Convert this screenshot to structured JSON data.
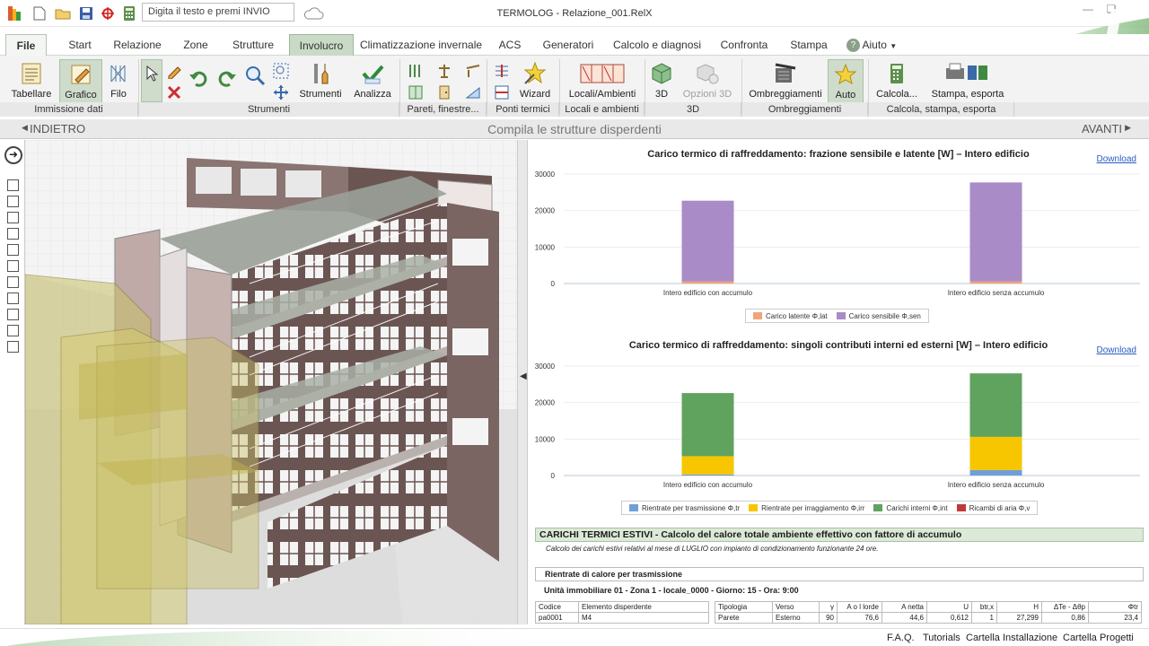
{
  "window": {
    "title": "TERMOLOG - Relazione_001.RelX",
    "search_placeholder": "Digita il testo e premi INVIO"
  },
  "tabs": [
    {
      "label": "File"
    },
    {
      "label": "Start"
    },
    {
      "label": "Relazione"
    },
    {
      "label": "Zone"
    },
    {
      "label": "Strutture"
    },
    {
      "label": "Involucro"
    },
    {
      "label": "Climatizzazione invernale"
    },
    {
      "label": "ACS"
    },
    {
      "label": "Generatori"
    },
    {
      "label": "Calcolo e diagnosi"
    },
    {
      "label": "Confronta"
    },
    {
      "label": "Stampa"
    },
    {
      "label": "Aiuto"
    }
  ],
  "active_tab": "Involucro",
  "ribbon": {
    "buttons": {
      "tabellare": "Tabellare",
      "grafico": "Grafico",
      "filo": "Filo",
      "strumenti": "Strumenti",
      "analizza": "Analizza",
      "wizard": "Wizard",
      "locali": "Locali/Ambienti",
      "btn3d": "3D",
      "opzioni3d": "Opzioni 3D",
      "ombreggiamenti": "Ombreggiamenti",
      "auto": "Auto",
      "calcola": "Calcola...",
      "stampa": "Stampa, esporta"
    },
    "groups": {
      "immissione": "Immissione dati",
      "strumenti": "Strumenti",
      "pareti": "Pareti, finestre...",
      "ponti": "Ponti termici",
      "locali": "Locali e ambienti",
      "g3d": "3D",
      "ombreggiamenti": "Ombreggiamenti",
      "calcola": "Calcola, stampa, esporta"
    }
  },
  "nav": {
    "back": "INDIETRO",
    "center": "Compila le strutture disperdenti",
    "forward": "AVANTI"
  },
  "charts": {
    "download_label": "Download",
    "chart1_title": "Carico termico di raffreddamento: frazione sensibile e latente [W] – Intero edificio",
    "chart2_title": "Carico termico di raffreddamento: singoli contributi interni ed esterni [W] – Intero edificio"
  },
  "chart_data": [
    {
      "type": "bar",
      "stacked": true,
      "title": "Carico termico di raffreddamento: frazione sensibile e latente [W] – Intero edificio",
      "categories": [
        "Intero edificio con accumulo",
        "Intero edificio senza accumulo"
      ],
      "ylim": [
        0,
        30000
      ],
      "yticks": [
        0,
        10000,
        20000,
        30000
      ],
      "legend_position": "bottom",
      "series": [
        {
          "name": "Carico latente Φ,lat",
          "color": "#f0a47a",
          "values": [
            600,
            600
          ]
        },
        {
          "name": "Carico sensibile Φ,sen",
          "color": "#a98bc7",
          "values": [
            22100,
            27100
          ]
        }
      ]
    },
    {
      "type": "bar",
      "stacked": true,
      "title": "Carico termico di raffreddamento: singoli contributi interni ed esterni [W] – Intero edificio",
      "categories": [
        "Intero edificio con accumulo",
        "Intero edificio senza accumulo"
      ],
      "ylim": [
        0,
        30000
      ],
      "yticks": [
        0,
        10000,
        20000,
        30000
      ],
      "legend_position": "bottom",
      "series": [
        {
          "name": "Rientrate per trasmissione Φ,tr",
          "color": "#6f9fd8",
          "values": [
            300,
            1500
          ]
        },
        {
          "name": "Rientrate per irraggiamento Φ,irr",
          "color": "#f7c600",
          "values": [
            5000,
            9100
          ]
        },
        {
          "name": "Carichi interni Φ,int",
          "color": "#5fa35f",
          "values": [
            17300,
            17400
          ]
        },
        {
          "name": "Ricambi di aria Φ,v",
          "color": "#c0393b",
          "values": [
            0,
            0
          ]
        }
      ]
    }
  ],
  "report": {
    "section_title": "CARICHI TERMICI ESTIVI - Calcolo del calore totale ambiente effettivo con fattore di accumulo",
    "section_desc": "Calcolo dei carichi estivi relativi al mese di LUGLIO con impianto di condizionamento funzionante 24 ore.",
    "subsection": "Rientrate di calore per trasmissione",
    "unit_line": "Unità immobiliare 01 - Zona 1 - locale_0000 - Giorno: 15 - Ora: 9:00",
    "left_headers": [
      "Codice",
      "Elemento disperdente"
    ],
    "left_row": [
      "pa0001",
      "M4"
    ],
    "right_headers": [
      "Tipologia",
      "Verso",
      "γ",
      "A o l lorde",
      "A netta",
      "U",
      "btr,x",
      "H",
      "ΔTe - Δθp",
      "Φtr"
    ],
    "right_row": [
      "Parete",
      "Esterno",
      "90",
      "76,6",
      "44,6",
      "0,612",
      "1",
      "27,299",
      "0,86",
      "23,4"
    ]
  },
  "statusbar": {
    "faq": "F.A.Q.",
    "tutorials": "Tutorials",
    "install": "Cartella Installazione",
    "projects": "Cartella Progetti"
  },
  "colors": {
    "accent_green": "#7db878",
    "tab_active": "#c9dbc6",
    "link_blue": "#2a5bbf"
  }
}
